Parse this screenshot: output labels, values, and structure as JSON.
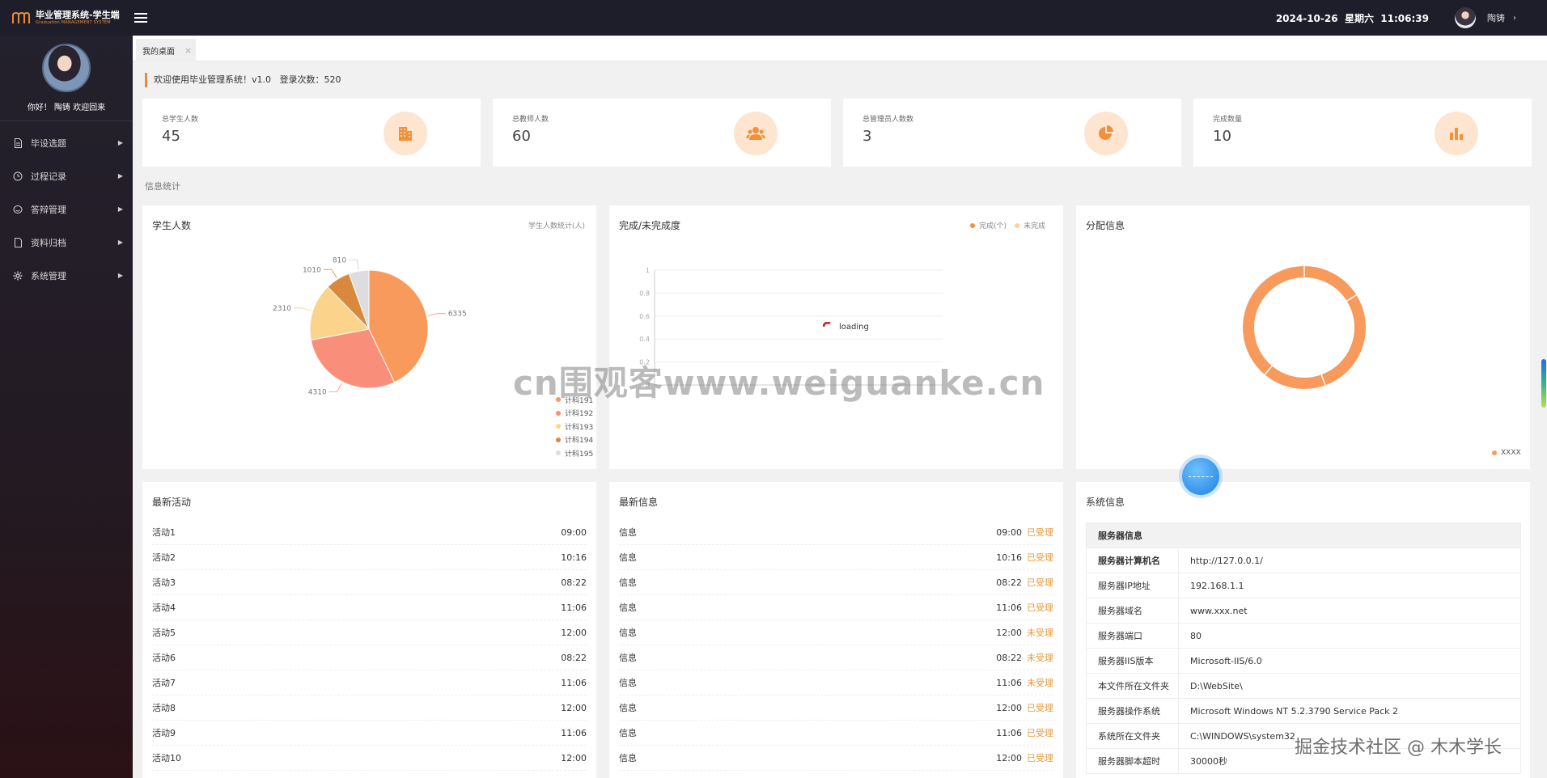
{
  "app": {
    "title": "毕业管理系统-学生端",
    "subtitle": "Graduation MANAGEMENT SYSTEM"
  },
  "header": {
    "datetime": "2024-10-26  星期六  11:06:39",
    "user_name": "陶铸"
  },
  "sidebar": {
    "greeting": "你好！ 陶铸 欢迎回来",
    "items": [
      {
        "label": "毕设选题",
        "icon": "document-icon"
      },
      {
        "label": "过程记录",
        "icon": "clock-icon"
      },
      {
        "label": "答辩管理",
        "icon": "chat-icon"
      },
      {
        "label": "资料归档",
        "icon": "file-icon"
      },
      {
        "label": "系统管理",
        "icon": "gear-icon"
      }
    ]
  },
  "tabs": [
    {
      "label": "我的桌面"
    }
  ],
  "welcome": "欢迎使用毕业管理系统！v1.0   登录次数：520",
  "stats": [
    {
      "label": "总学生人数",
      "value": "45",
      "icon": "building-icon"
    },
    {
      "label": "总教师人数",
      "value": "60",
      "icon": "users-icon"
    },
    {
      "label": "总管理员人数数",
      "value": "3",
      "icon": "pie-icon"
    },
    {
      "label": "完成数量",
      "value": "10",
      "icon": "bar-chart-icon"
    }
  ],
  "section_title": "信息统计",
  "charts": {
    "students": {
      "title": "学生人数",
      "subtitle": "学生人数统计(人)"
    },
    "completion": {
      "title": "完成/未完成度",
      "legend": [
        "完成(个)",
        "未完成"
      ],
      "loading": "loading"
    },
    "distribution": {
      "title": "分配信息",
      "legend": "XXXX"
    }
  },
  "chart_data": [
    {
      "type": "pie",
      "title": "学生人数",
      "subtitle": "学生人数统计(人)",
      "categories": [
        "计科191",
        "计科192",
        "计科193",
        "计科194",
        "计科195"
      ],
      "values": [
        6335,
        4310,
        2310,
        1010,
        810
      ],
      "colors": [
        "#f79a5c",
        "#f98e7a",
        "#fcd38a",
        "#d9893c",
        "#dddddd"
      ],
      "legend": "bottom-right"
    },
    {
      "type": "line",
      "title": "完成/未完成度",
      "series": [
        {
          "name": "完成(个)",
          "values": []
        },
        {
          "name": "未完成",
          "values": []
        }
      ],
      "yticks": [
        "0",
        "0.2",
        "0.4",
        "0.6",
        "0.8",
        "1"
      ],
      "ylim": [
        0,
        1
      ],
      "legend": "top-right"
    },
    {
      "type": "pie",
      "title": "分配信息",
      "categories": [
        "XXXX"
      ],
      "values": [
        1
      ],
      "colors": [
        "#f79a5c"
      ],
      "donut": true,
      "legend": "bottom-right"
    }
  ],
  "activities": {
    "title": "最新活动",
    "rows": [
      {
        "name": "活动1",
        "time": "09:00"
      },
      {
        "name": "活动2",
        "time": "10:16"
      },
      {
        "name": "活动3",
        "time": "08:22"
      },
      {
        "name": "活动4",
        "time": "11:06"
      },
      {
        "name": "活动5",
        "time": "12:00"
      },
      {
        "name": "活动6",
        "time": "08:22"
      },
      {
        "name": "活动7",
        "time": "11:06"
      },
      {
        "name": "活动8",
        "time": "12:00"
      },
      {
        "name": "活动9",
        "time": "11:06"
      },
      {
        "name": "活动10",
        "time": "12:00"
      }
    ]
  },
  "messages": {
    "title": "最新信息",
    "rows": [
      {
        "name": "信息",
        "time": "09:00",
        "status": "已受理"
      },
      {
        "name": "信息",
        "time": "10:16",
        "status": "已受理"
      },
      {
        "name": "信息",
        "time": "08:22",
        "status": "已受理"
      },
      {
        "name": "信息",
        "time": "11:06",
        "status": "已受理"
      },
      {
        "name": "信息",
        "time": "12:00",
        "status": "未受理"
      },
      {
        "name": "信息",
        "time": "08:22",
        "status": "未受理"
      },
      {
        "name": "信息",
        "time": "11:06",
        "status": "未受理"
      },
      {
        "name": "信息",
        "time": "12:00",
        "status": "已受理"
      },
      {
        "name": "信息",
        "time": "11:06",
        "status": "已受理"
      },
      {
        "name": "信息",
        "time": "12:00",
        "status": "已受理"
      }
    ]
  },
  "system_info": {
    "title": "系统信息",
    "header": "服务器信息",
    "rows": [
      {
        "key": "服务器计算机名",
        "value": "http://127.0.0.1/",
        "bold": true
      },
      {
        "key": "服务器IP地址",
        "value": "192.168.1.1"
      },
      {
        "key": "服务器域名",
        "value": "www.xxx.net"
      },
      {
        "key": "服务器端口",
        "value": "80"
      },
      {
        "key": "服务器IIS版本",
        "value": "Microsoft-IIS/6.0"
      },
      {
        "key": "本文件所在文件夹",
        "value": "D:\\WebSite\\"
      },
      {
        "key": "服务器操作系统",
        "value": "Microsoft Windows NT 5.2.3790 Service Pack 2"
      },
      {
        "key": "系统所在文件夹",
        "value": "C:\\WINDOWS\\system32"
      },
      {
        "key": "服务器脚本超时",
        "value": "30000秒"
      }
    ]
  },
  "watermarks": [
    "cn围观客www.weiguanke.cn",
    "掘金技术社区 @ 木木学长"
  ]
}
